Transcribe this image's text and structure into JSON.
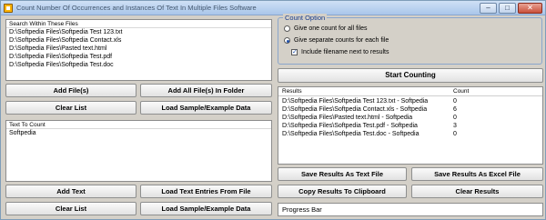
{
  "window": {
    "title": "Count Number Of Occurrences and Instances Of Text In Multiple Files Software",
    "controls": [
      "–",
      "□",
      "✕"
    ]
  },
  "search_files": {
    "header": "Search Within These Files",
    "files": [
      "D:\\Softpedia Files\\Softpedia Test 123.txt",
      "D:\\Softpedia Files\\Softpedia Contact.xls",
      "D:\\Softpedia Files\\Pasted text.html",
      "D:\\Softpedia Files\\Softpedia Test.pdf",
      "D:\\Softpedia Files\\Softpedia Test.doc"
    ]
  },
  "file_buttons": {
    "add_files": "Add File(s)",
    "add_folder": "Add All File(s) In Folder",
    "clear_list": "Clear List",
    "load_sample": "Load Sample/Example Data"
  },
  "text_to_count": {
    "header": "Text To Count",
    "entries": [
      "Softpedia"
    ]
  },
  "text_buttons": {
    "add_text": "Add Text",
    "load_entries": "Load Text Entries From File",
    "clear_list": "Clear List",
    "load_sample": "Load Sample/Example Data"
  },
  "count_option": {
    "title": "Count Option",
    "option_one": "Give one count for all files",
    "option_separate": "Give separate counts for each file",
    "include_filename": "Include filename next to results",
    "selected": "option_separate",
    "include_checked": true
  },
  "start_button": "Start Counting",
  "results": {
    "col_results": "Results",
    "col_count": "Count",
    "rows": [
      {
        "name": "D:\\Softpedia Files\\Softpedia Test 123.txt - Softpedia",
        "count": "0"
      },
      {
        "name": "D:\\Softpedia Files\\Softpedia Contact.xls - Softpedia",
        "count": "6"
      },
      {
        "name": "D:\\Softpedia Files\\Pasted text.html - Softpedia",
        "count": "0"
      },
      {
        "name": "D:\\Softpedia Files\\Softpedia Test.pdf - Softpedia",
        "count": "3"
      },
      {
        "name": "D:\\Softpedia Files\\Softpedia Test.doc - Softpedia",
        "count": "0"
      }
    ]
  },
  "result_buttons": {
    "save_text": "Save Results As Text File",
    "save_excel": "Save Results As Excel File",
    "copy_clipboard": "Copy Results To Clipboard",
    "clear_results": "Clear Results"
  },
  "progress_bar": "Progress Bar"
}
